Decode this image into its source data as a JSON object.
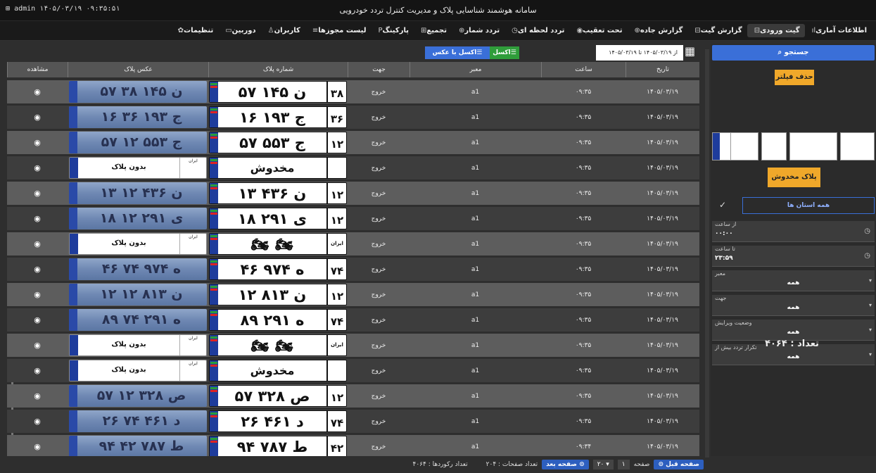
{
  "titlebar": {
    "title": "سامانه هوشمند شناسایی پلاک و مدیریت کنترل تردد خودرویی",
    "user_info": "admin  ۱۴۰۵/۰۳/۱۹  ۰۹:۳۵:۵۱"
  },
  "menu": [
    {
      "icon": "ıl",
      "label": "اطلاعات آماری"
    },
    {
      "icon": "⊟",
      "label": "گیت ورودی"
    },
    {
      "icon": "⊟",
      "label": "گزارش گیت"
    },
    {
      "icon": "⊕",
      "label": "گزارش جاده"
    },
    {
      "icon": "◉",
      "label": "تحت تعقیب"
    },
    {
      "icon": "◷",
      "label": "تردد لحظه ای"
    },
    {
      "icon": "⊕",
      "label": "تردد شمار"
    },
    {
      "icon": "⊞",
      "label": "تجمیع"
    },
    {
      "icon": "P",
      "label": "پارکینگ"
    },
    {
      "icon": "≡",
      "label": "لیست مجوزها"
    },
    {
      "icon": "♙",
      "label": "کاربران"
    },
    {
      "icon": "▭",
      "label": "دوربین"
    },
    {
      "icon": "✿",
      "label": "تنظیمات"
    }
  ],
  "filters": {
    "search_label": "جستجو",
    "clear_label": "حذف فیلتر",
    "damaged_label": "پلاک مخدوش",
    "province_label": "همه استان ها",
    "from_time_label": "از ساعت",
    "from_time_value": "۰۰:۰۰",
    "to_time_label": "تا ساعت",
    "to_time_value": "۲۳:۵۹",
    "gate_label": "معبر",
    "gate_value": "همه",
    "direction_label": "جهت",
    "direction_value": "همه",
    "edit_status_label": "وضعیت ویرایش",
    "edit_status_value": "همه",
    "repeat_label": "تکرار تردد بیش از",
    "repeat_value": "همه",
    "count_text": "تعداد : ۴۰۶۴"
  },
  "toolbar": {
    "date_range": "از ۱۴۰۵/۰۳/۱۹ تا ۱۴۰۵/۰۳/۱۹",
    "excel_label": "اکسل",
    "excel_img_label": "اکسل با عکس"
  },
  "table": {
    "headers": [
      "تاریخ",
      "ساعت",
      "معبر",
      "جهت",
      "شماره پلاک",
      "عکس پلاک",
      "مشاهده"
    ],
    "rows": [
      {
        "date": "۱۴۰۵/۰۳/۱۹",
        "time": "۰۹:۳۵",
        "gate": "a1",
        "dir": "خروج",
        "type": "plate",
        "plate": "۵۷ ن ۱۴۵",
        "code": "۳۸",
        "img": "۵۷ ن ۱۴۵ ۳۸"
      },
      {
        "date": "۱۴۰۵/۰۳/۱۹",
        "time": "۰۹:۳۵",
        "gate": "a1",
        "dir": "خروج",
        "type": "plate",
        "plate": "۱۶ ج ۱۹۳",
        "code": "۳۶",
        "img": "۱۶ ج ۱۹۳ ۳۶"
      },
      {
        "date": "۱۴۰۵/۰۳/۱۹",
        "time": "۰۹:۳۵",
        "gate": "a1",
        "dir": "خروج",
        "type": "plate",
        "plate": "۵۷ ج ۵۵۳",
        "code": "۱۲",
        "img": "۵۷ ج ۵۵۳ ۱۲"
      },
      {
        "date": "۱۴۰۵/۰۳/۱۹",
        "time": "۰۹:۳۵",
        "gate": "a1",
        "dir": "خروج",
        "type": "damaged",
        "plate": "مخدوش",
        "code": "",
        "img": "بدون پلاک"
      },
      {
        "date": "۱۴۰۵/۰۳/۱۹",
        "time": "۰۹:۳۵",
        "gate": "a1",
        "dir": "خروج",
        "type": "plate",
        "plate": "۱۳ ن ۴۳۶",
        "code": "۱۲",
        "img": "۱۳ ن ۴۳۶ ۱۲"
      },
      {
        "date": "۱۴۰۵/۰۳/۱۹",
        "time": "۰۹:۳۵",
        "gate": "a1",
        "dir": "خروج",
        "type": "plate",
        "plate": "۱۸ ی ۲۹۱",
        "code": "۱۲",
        "img": "۱۸ ی ۲۹۱ ۱۲"
      },
      {
        "date": "۱۴۰۵/۰۳/۱۹",
        "time": "۰۹:۳۵",
        "gate": "a1",
        "dir": "خروج",
        "type": "moto",
        "plate": "",
        "code": "",
        "img": "بدون پلاک"
      },
      {
        "date": "۱۴۰۵/۰۳/۱۹",
        "time": "۰۹:۳۵",
        "gate": "a1",
        "dir": "خروج",
        "type": "plate",
        "plate": "۴۶ ه ۹۷۴",
        "code": "۷۴",
        "img": "۴۶ ه ۹۷۴ ۷۴"
      },
      {
        "date": "۱۴۰۵/۰۳/۱۹",
        "time": "۰۹:۳۵",
        "gate": "a1",
        "dir": "خروج",
        "type": "plate",
        "plate": "۱۲ ن ۸۱۳",
        "code": "۱۲",
        "img": "۱۲ ن ۸۱۳ ۱۲"
      },
      {
        "date": "۱۴۰۵/۰۳/۱۹",
        "time": "۰۹:۳۵",
        "gate": "a1",
        "dir": "خروج",
        "type": "plate",
        "plate": "۸۹ ه ۲۹۱",
        "code": "۷۴",
        "img": "۸۹ ه ۲۹۱ ۷۴"
      },
      {
        "date": "۱۴۰۵/۰۳/۱۹",
        "time": "۰۹:۳۵",
        "gate": "a1",
        "dir": "خروج",
        "type": "moto",
        "plate": "",
        "code": "",
        "img": "بدون پلاک"
      },
      {
        "date": "۱۴۰۵/۰۳/۱۹",
        "time": "۰۹:۳۵",
        "gate": "a1",
        "dir": "خروج",
        "type": "damaged",
        "plate": "مخدوش",
        "code": "",
        "img": "بدون پلاک"
      },
      {
        "date": "۱۴۰۵/۰۳/۱۹",
        "time": "۰۹:۳۵",
        "gate": "a1",
        "dir": "خروج",
        "type": "plate",
        "plate": "۵۷ ص ۳۲۸",
        "code": "۱۲",
        "img": "۵۷ ص ۳۲۸ ۱۲"
      },
      {
        "date": "۱۴۰۵/۰۳/۱۹",
        "time": "۰۹:۳۵",
        "gate": "a1",
        "dir": "خروج",
        "type": "plate",
        "plate": "۲۶ د ۴۶۱",
        "code": "۷۴",
        "img": "۲۶ د ۴۶۱ ۷۴"
      },
      {
        "date": "۱۴۰۵/۰۳/۱۹",
        "time": "۰۹:۳۴",
        "gate": "a1",
        "dir": "خروج",
        "type": "plate",
        "plate": "۹۴ ط ۷۸۷",
        "code": "۴۲",
        "img": "۹۴ ط ۷۸۷ ۴۲"
      }
    ],
    "no_plate_code": "ایران",
    "moto_text": "ایران"
  },
  "pager": {
    "prev_label": "صفحه قبل",
    "page_label": "صفحه",
    "page_value": "۱",
    "per_page": "۲۰",
    "next_label": "صفحه بعد",
    "pages_text": "تعداد صفحات : ۲۰۴",
    "records_text": "تعداد رکوردها : ۴۰۶۴"
  },
  "colors": {
    "accent": "#3a6fd8",
    "warning": "#f0a82a",
    "excel": "#2f9d3a"
  }
}
